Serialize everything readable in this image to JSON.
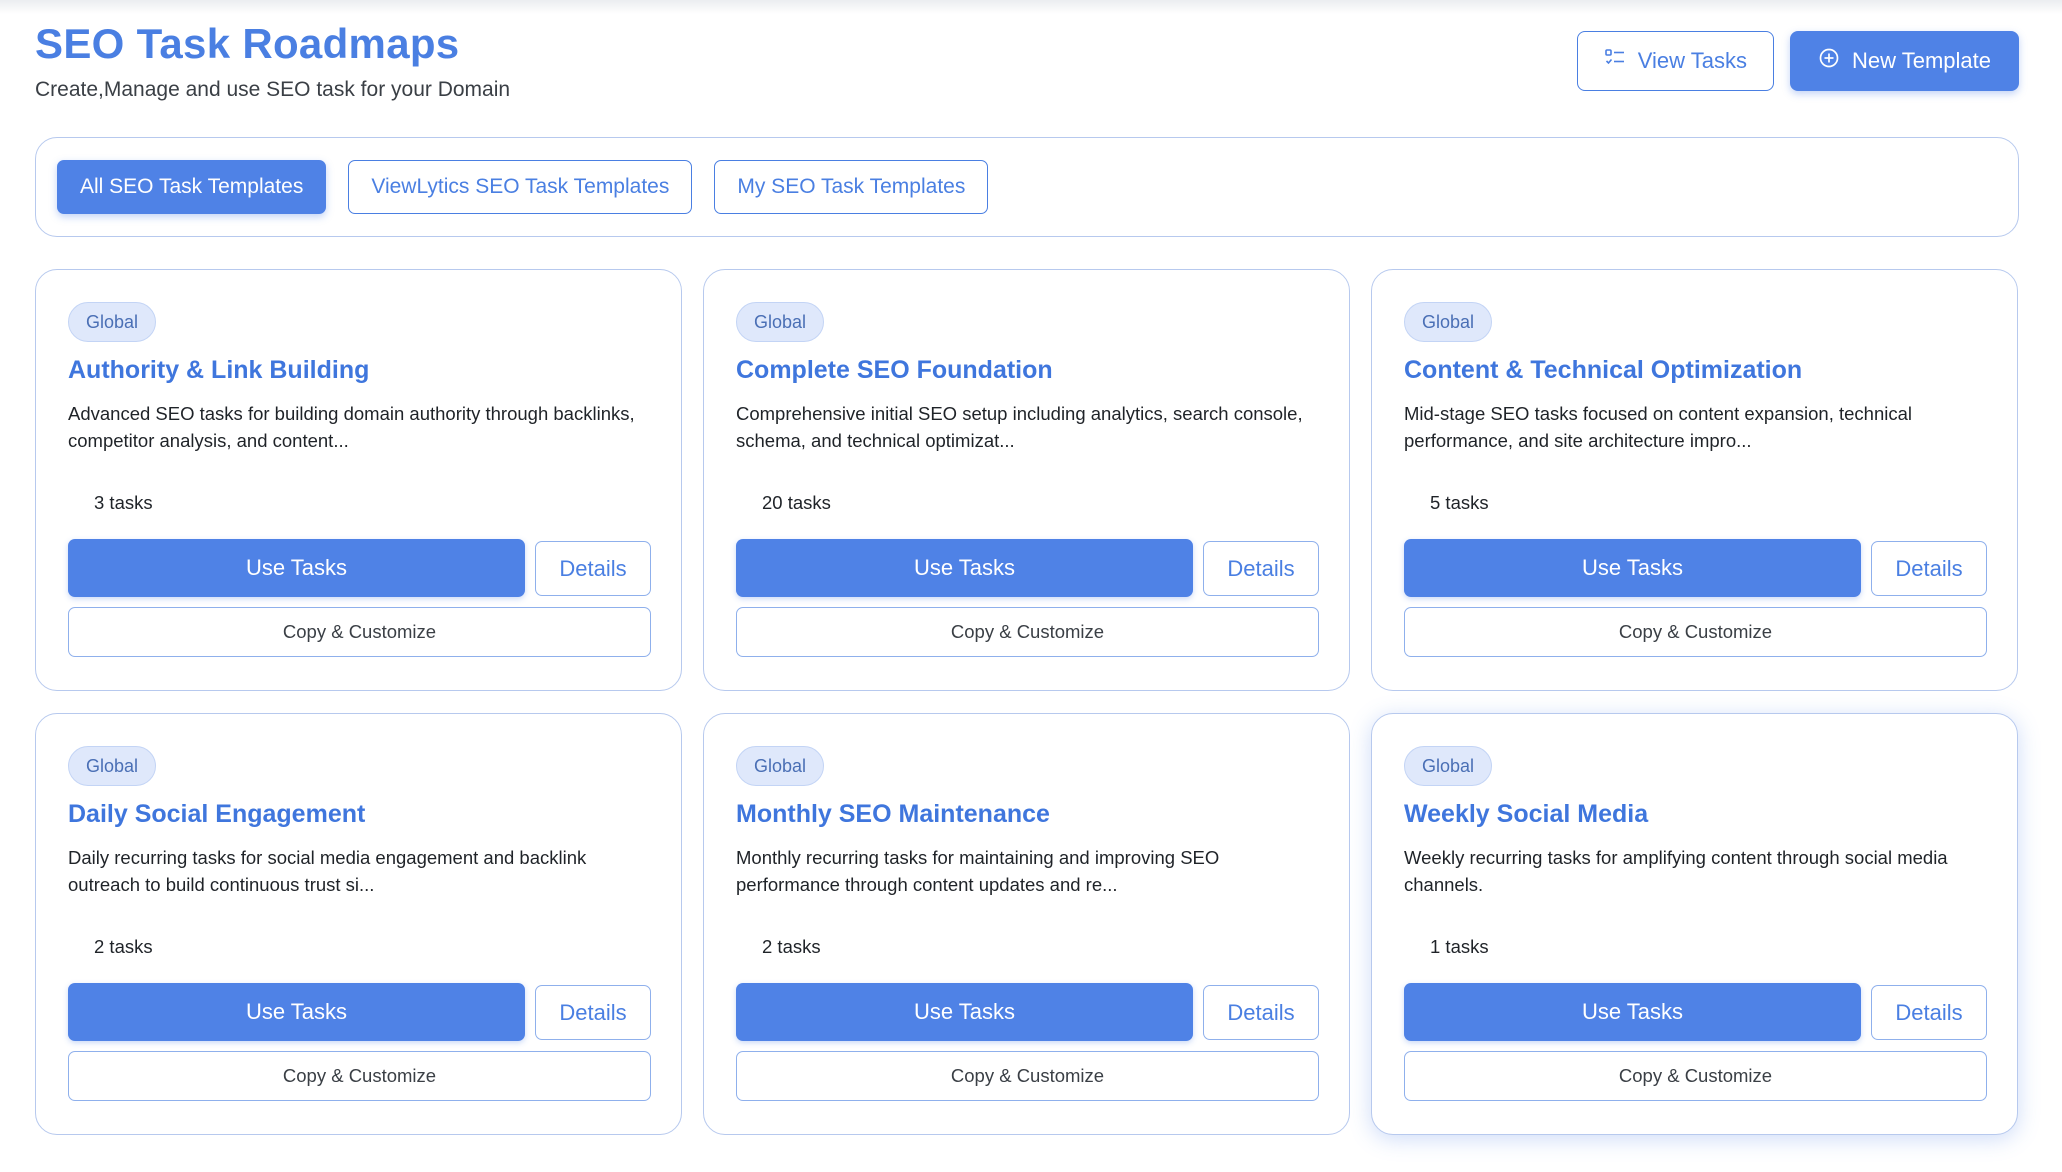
{
  "header": {
    "title": "SEO Task Roadmaps",
    "subtitle": "Create,Manage and use SEO task for your Domain",
    "view_tasks_label": "View Tasks",
    "new_template_label": "New Template"
  },
  "filters": {
    "all_label": "All SEO Task Templates",
    "viewlytics_label": "ViewLytics SEO Task Templates",
    "mine_label": "My SEO Task Templates",
    "active": "All SEO Task Templates"
  },
  "colors": {
    "accent": "#4f82e6",
    "title": "#4a7fe2",
    "badge_bg": "#dfe8fb",
    "border": "#b7c9ee"
  },
  "cards": [
    {
      "badge": "Global",
      "title": "Authority & Link Building",
      "description": "Advanced SEO tasks for building domain authority through backlinks, competitor analysis, and content...",
      "count": "3 tasks",
      "use_label": "Use Tasks",
      "details_label": "Details",
      "copy_label": "Copy & Customize"
    },
    {
      "badge": "Global",
      "title": "Complete SEO Foundation",
      "description": "Comprehensive initial SEO setup including analytics, search console, schema, and technical optimizat...",
      "count": "20 tasks",
      "use_label": "Use Tasks",
      "details_label": "Details",
      "copy_label": "Copy & Customize"
    },
    {
      "badge": "Global",
      "title": "Content & Technical Optimization",
      "description": "Mid-stage SEO tasks focused on content expansion, technical performance, and site architecture impro...",
      "count": "5 tasks",
      "use_label": "Use Tasks",
      "details_label": "Details",
      "copy_label": "Copy & Customize"
    },
    {
      "badge": "Global",
      "title": "Daily Social Engagement",
      "description": "Daily recurring tasks for social media engagement and backlink outreach to build continuous trust si...",
      "count": "2 tasks",
      "use_label": "Use Tasks",
      "details_label": "Details",
      "copy_label": "Copy & Customize"
    },
    {
      "badge": "Global",
      "title": "Monthly SEO Maintenance",
      "description": "Monthly recurring tasks for maintaining and improving SEO performance through content updates and re...",
      "count": "2 tasks",
      "use_label": "Use Tasks",
      "details_label": "Details",
      "copy_label": "Copy & Customize"
    },
    {
      "badge": "Global",
      "title": "Weekly Social Media",
      "description": "Weekly recurring tasks for amplifying content through social media channels.",
      "count": "1 tasks",
      "use_label": "Use Tasks",
      "details_label": "Details",
      "copy_label": "Copy & Customize"
    }
  ]
}
